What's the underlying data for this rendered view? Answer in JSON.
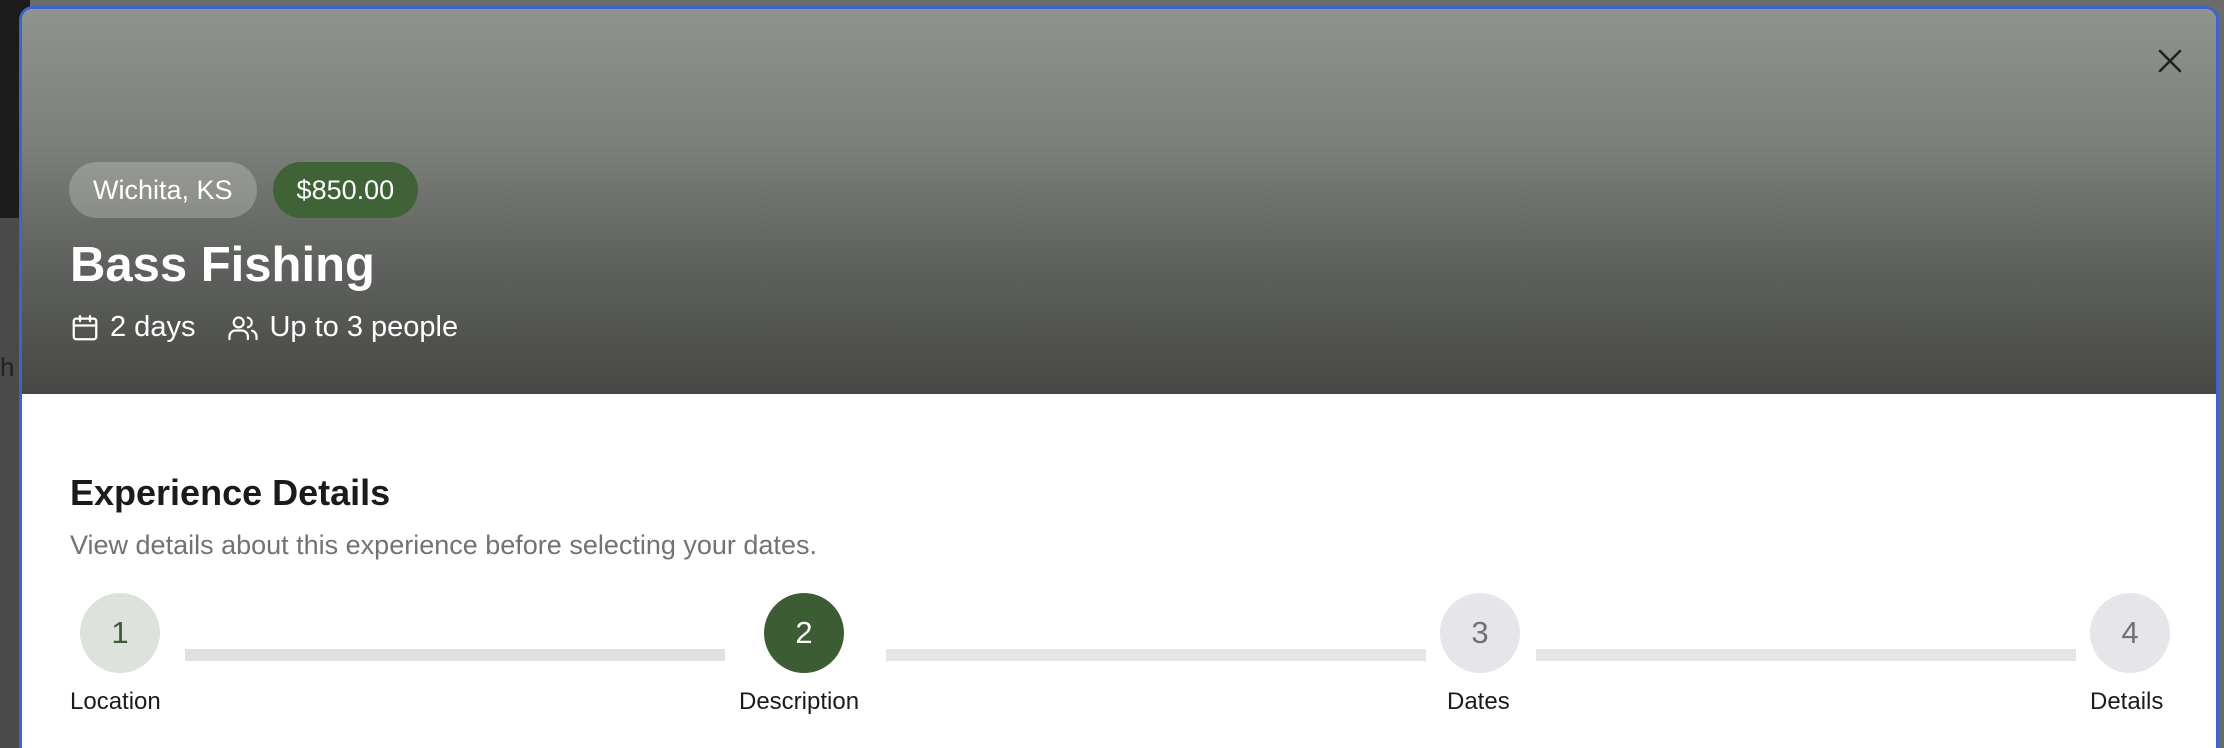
{
  "backdrop": {
    "fragment": "h"
  },
  "experience": {
    "location": "Wichita, KS",
    "price": "$850.00",
    "title": "Bass Fishing",
    "duration": "2 days",
    "capacity": "Up to 3 people"
  },
  "details": {
    "heading": "Experience Details",
    "description": "View details about this experience before selecting your dates."
  },
  "steps": [
    {
      "number": "1",
      "label": "Location",
      "state": "done"
    },
    {
      "number": "2",
      "label": "Description",
      "state": "active"
    },
    {
      "number": "3",
      "label": "Dates",
      "state": "todo"
    },
    {
      "number": "4",
      "label": "Details",
      "state": "todo"
    }
  ],
  "icons": {
    "close": "close-icon",
    "calendar": "calendar-icon",
    "people": "users-icon"
  },
  "colors": {
    "accent": "#3c5c33",
    "step_done": "#dde2dc",
    "step_todo": "#e6e6ea",
    "modal_border": "#3d64c6"
  }
}
